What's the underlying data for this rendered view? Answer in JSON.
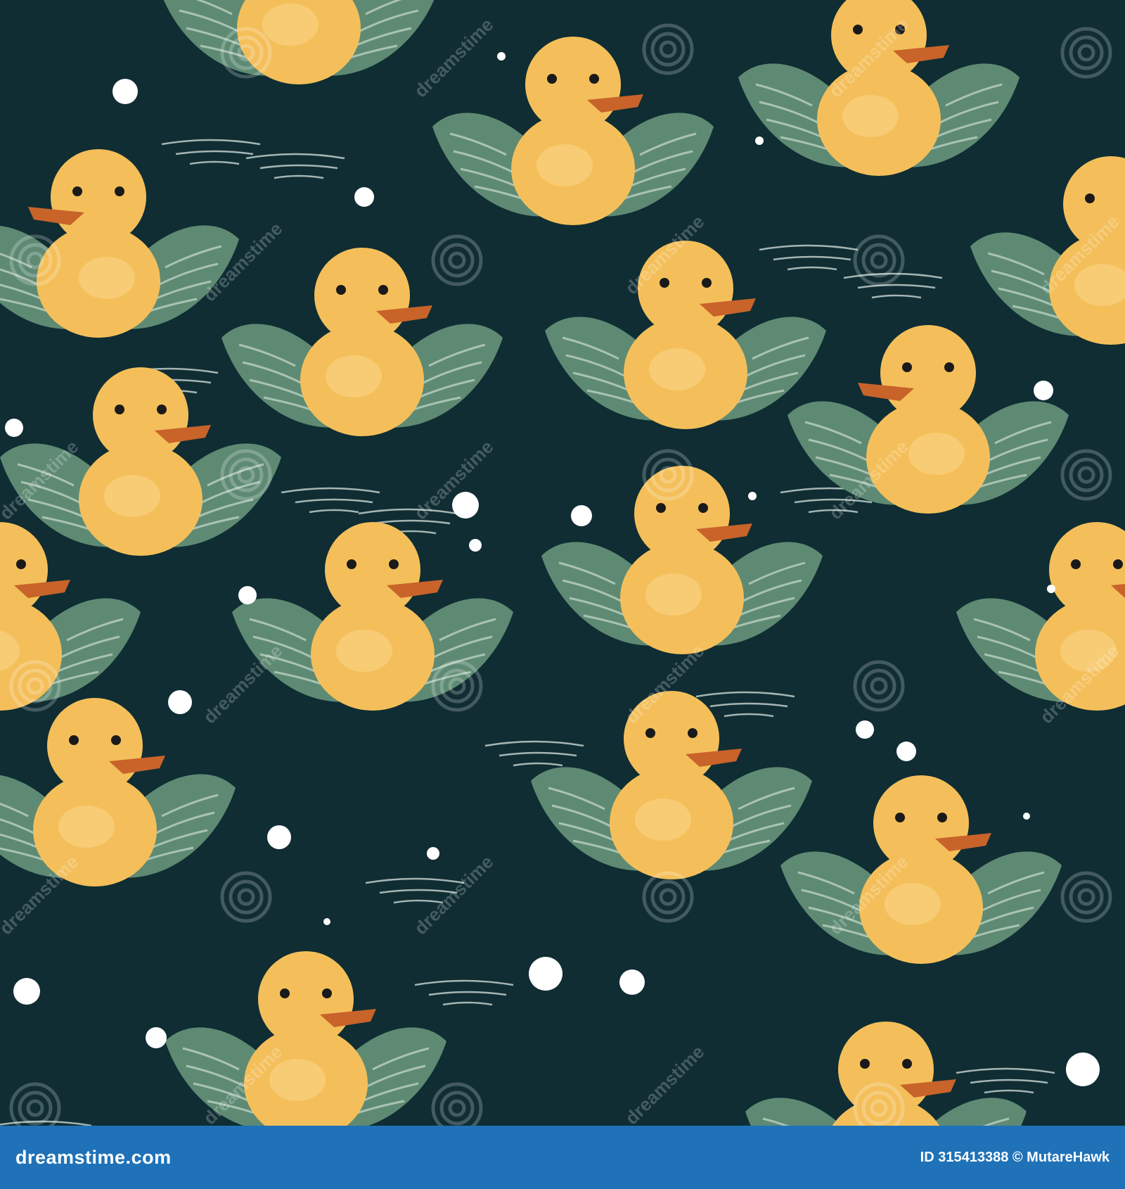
{
  "image": {
    "background_color": "#0f2d33",
    "duck_body_color": "#f4bf5a",
    "duck_beak_color": "#c8632a",
    "wing_color": "#5e8a73",
    "bubble_color": "#ffffff",
    "subject": "seamless pattern of yellow rubber ducks with green wings floating on dark water with white bubbles and ripples"
  },
  "watermark": {
    "text": "dreamstime",
    "icon": "swirl-icon"
  },
  "footer": {
    "background_color": "#1f72b8",
    "logo_text": "dreamstime.com",
    "image_id_text": "ID 315413388 © MutareHawk"
  }
}
